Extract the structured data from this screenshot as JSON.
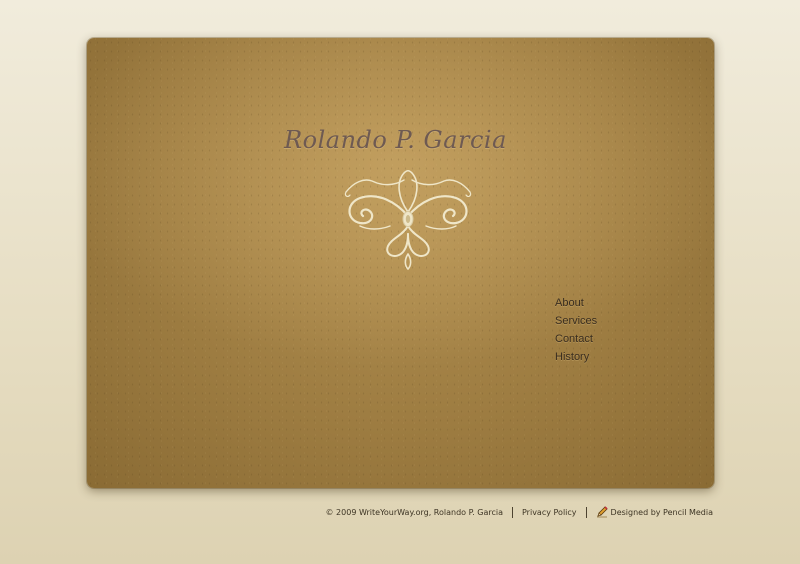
{
  "site": {
    "title": "Rolando P. Garcia"
  },
  "nav": {
    "items": [
      {
        "label": "About"
      },
      {
        "label": "Services"
      },
      {
        "label": "Contact"
      },
      {
        "label": "History"
      }
    ]
  },
  "footer": {
    "copyright": "© 2009 WriteYourWay.org, Rolando P. Garcia",
    "privacy": "Privacy Policy",
    "designer": "Designed by Pencil Media"
  },
  "icons": {
    "ornament": "flourish-ornament-icon",
    "pencil": "pencil-icon"
  },
  "colors": {
    "background": "#ebe3cb",
    "card": "#9d7c41",
    "title": "#6e5a52",
    "ornament": "#efe6c8",
    "nav_text": "#3a2e20"
  }
}
